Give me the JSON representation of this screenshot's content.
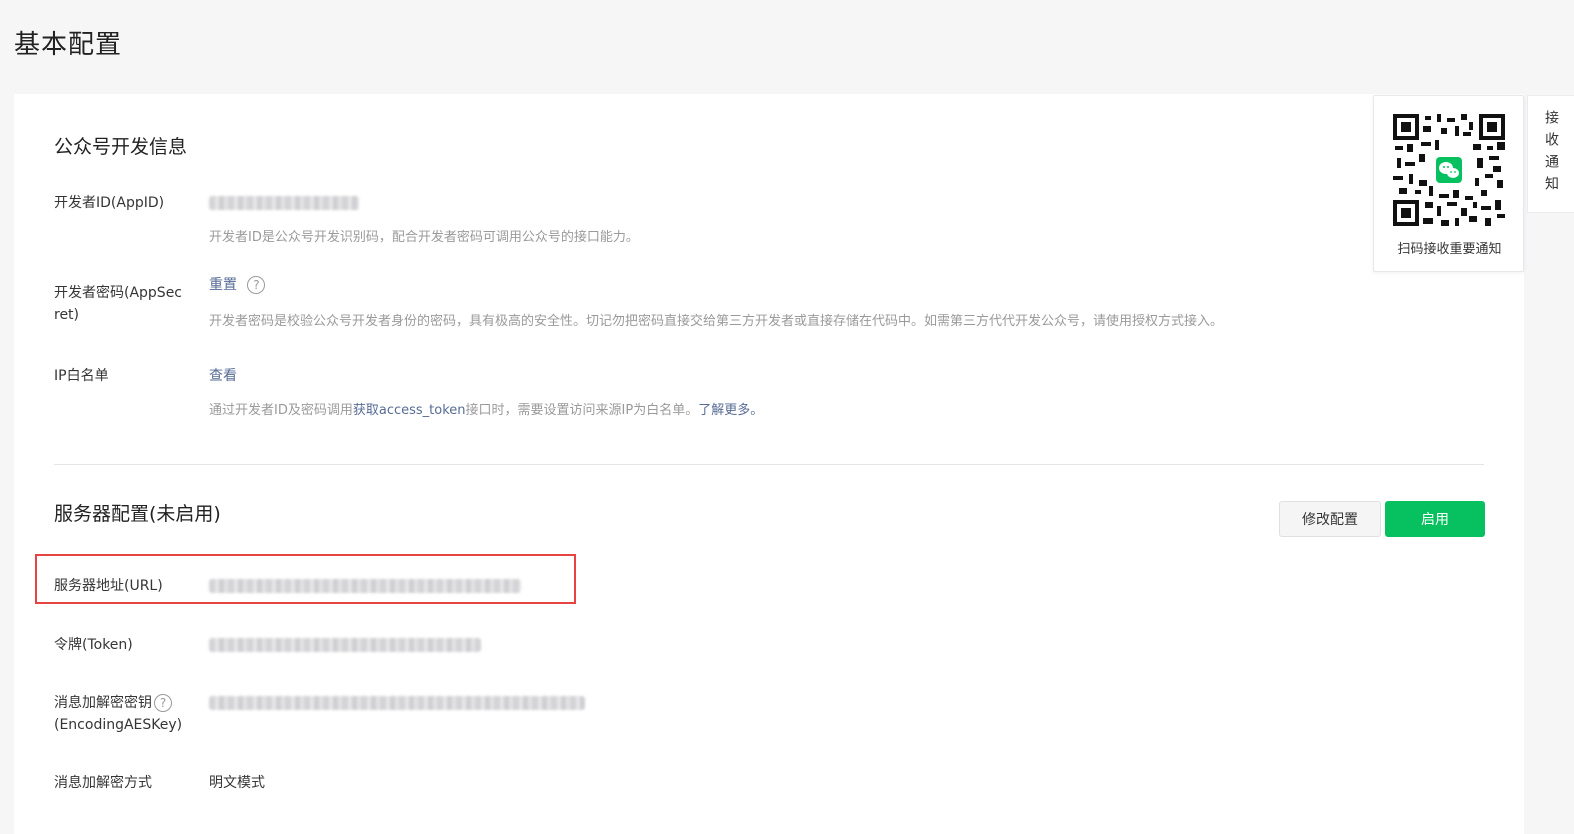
{
  "page": {
    "title": "基本配置"
  },
  "dev_info": {
    "section_title": "公众号开发信息",
    "appid": {
      "label": "开发者ID(AppID)",
      "desc": "开发者ID是公众号开发识别码，配合开发者密码可调用公众号的接口能力。"
    },
    "appsecret": {
      "label_line1": "开发者密码(AppSec",
      "label_line2": "ret)",
      "action": "重置",
      "help": "?",
      "desc": "开发者密码是校验公众号开发者身份的密码，具有极高的安全性。切记勿把密码直接交给第三方开发者或直接存储在代码中。如需第三方代代开发公众号，请使用授权方式接入。"
    },
    "ip_whitelist": {
      "label": "IP白名单",
      "action": "查看",
      "desc_prefix": "通过开发者ID及密码调用",
      "desc_link": "获取access_token",
      "desc_middle": "接口时，需要设置访问来源IP为白名单。",
      "desc_more": "了解更多。"
    }
  },
  "server_config": {
    "section_title": "服务器配置(未启用)",
    "modify_button": "修改配置",
    "enable_button": "启用",
    "url": {
      "label": "服务器地址(URL)"
    },
    "token": {
      "label": "令牌(Token)"
    },
    "aes_key": {
      "label_line1": "消息加解密密钥",
      "label_line2": "(EncodingAESKey)",
      "help": "?"
    },
    "encrypt_mode": {
      "label": "消息加解密方式",
      "value": "明文模式"
    }
  },
  "qr_panel": {
    "caption": "扫码接收重要通知",
    "icon": "wechat-icon"
  },
  "side_tab": {
    "label": "接收通知"
  },
  "colors": {
    "primary": "#07c160",
    "link": "#576b95",
    "highlight": "#e84343",
    "muted_text": "#9a9a9a"
  }
}
